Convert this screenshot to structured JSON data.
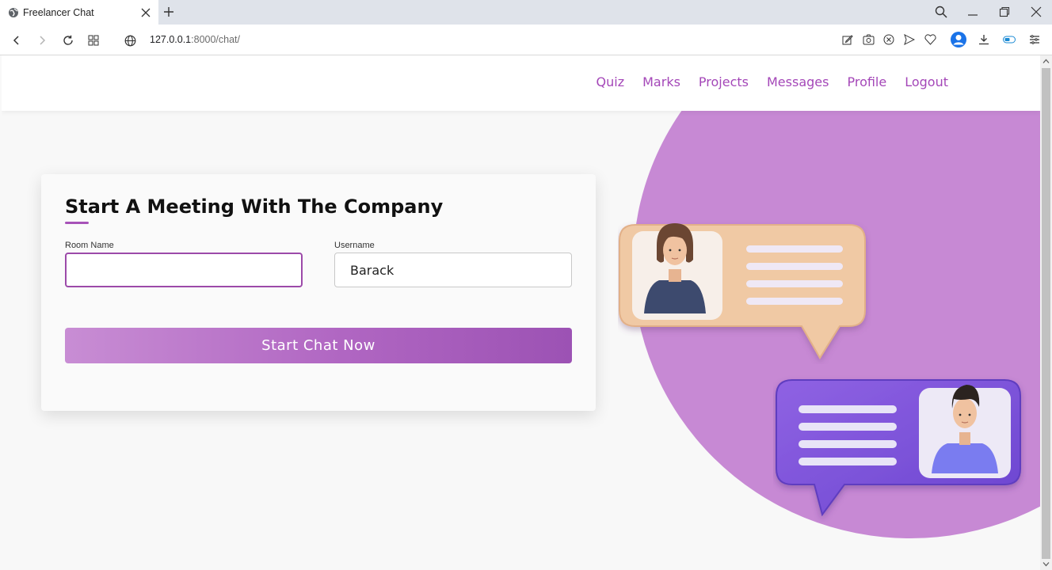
{
  "browser": {
    "tab_title": "Freelancer Chat",
    "url_host": "127.0.0.1",
    "url_path": ":8000/chat/"
  },
  "nav": {
    "items": [
      {
        "label": "Quiz"
      },
      {
        "label": "Marks"
      },
      {
        "label": "Projects"
      },
      {
        "label": "Messages"
      },
      {
        "label": "Profile"
      },
      {
        "label": "Logout"
      }
    ]
  },
  "form": {
    "title": "Start A Meeting With The Company",
    "room_label": "Room Name",
    "room_value": "",
    "username_label": "Username",
    "username_value": "Barack",
    "submit_label": "Start Chat Now"
  },
  "colors": {
    "accent": "#a447b8",
    "hero": "#c789d4",
    "button_start": "#c88dd4",
    "button_end": "#9c52b4"
  },
  "icons": {
    "favicon": "globe-icon",
    "back": "arrow-left-icon",
    "forward": "arrow-right-icon",
    "reload": "reload-icon",
    "tabs_grid": "grid-icon",
    "site_info": "globe-icon",
    "toolbar": [
      "edit-icon",
      "camera-icon",
      "block-icon",
      "send-icon",
      "heart-icon",
      "avatar-icon",
      "download-icon",
      "toggle-icon",
      "menu-icon"
    ]
  }
}
